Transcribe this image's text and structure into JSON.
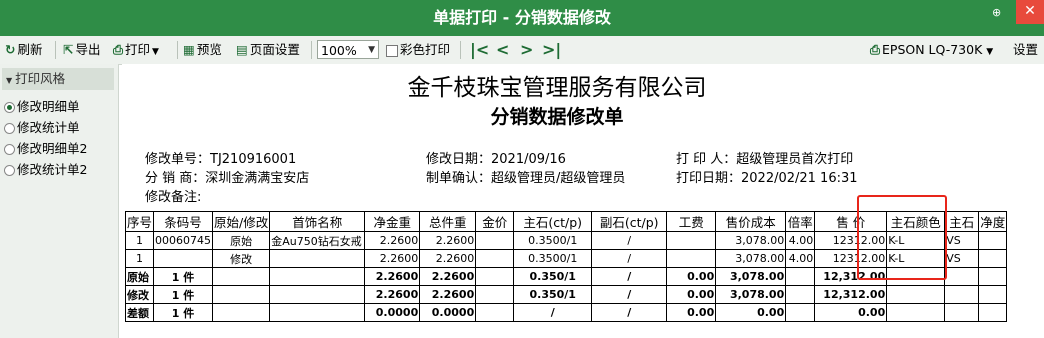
{
  "window": {
    "title": "单据打印 - 分销数据修改",
    "pin_icon": "pin-icon",
    "close_icon": "close-icon"
  },
  "toolbar": {
    "refresh": "刷新",
    "export": "导出",
    "print": "打印",
    "preview": "预览",
    "page_setup": "页面设置",
    "zoom": "100%",
    "color_print": "彩色打印",
    "printer": "EPSON LQ-730K",
    "settings": "设置"
  },
  "left_panel": {
    "header": "打印风格",
    "items": [
      "修改明细单",
      "修改统计单",
      "修改明细单2",
      "修改统计单2"
    ],
    "selected": 0
  },
  "document": {
    "company": "金千枝珠宝管理服务有限公司",
    "title": "分销数据修改单",
    "order_no": "修改单号：TJ210916001",
    "distributor": "分 销 商：深圳金满满宝安店",
    "remark": "修改备注:",
    "modify_date": "修改日期：2021/09/16",
    "confirm": "制单确认：超级管理员/超级管理员",
    "printer_person": "打 印 人：超级管理员首次打印",
    "print_date": "打印日期：2022/02/21 16:31",
    "columns": [
      "序号",
      "条码号",
      "原始/修改",
      "首饰名称",
      "净金重",
      "总件重",
      "金价",
      "主石(ct/p)",
      "副石(ct/p)",
      "工费",
      "售价成本",
      "倍率",
      "售 价",
      "主石颜色",
      "主石",
      "净度"
    ],
    "rows": [
      [
        "1",
        "00060745",
        "原始",
        "金Au750钻石女戒",
        "2.2600",
        "2.2600",
        "",
        "0.3500/1",
        "/",
        "",
        "3,078.00",
        "4.00",
        "12312.00",
        "K-L",
        "VS",
        ""
      ],
      [
        "1",
        "",
        "修改",
        "",
        "2.2600",
        "2.2600",
        "",
        "0.3500/1",
        "/",
        "",
        "3,078.00",
        "4.00",
        "12312.00",
        "K-L",
        "VS",
        ""
      ]
    ],
    "summary": [
      [
        "原始",
        "1 件",
        "",
        "",
        "2.2600",
        "2.2600",
        "",
        "0.350/1",
        "/",
        "0.00",
        "3,078.00",
        "",
        "12,312.00",
        "",
        "",
        ""
      ],
      [
        "修改",
        "1 件",
        "",
        "",
        "2.2600",
        "2.2600",
        "",
        "0.350/1",
        "/",
        "0.00",
        "3,078.00",
        "",
        "12,312.00",
        "",
        "",
        ""
      ],
      [
        "差额",
        "1 件",
        "",
        "",
        "0.0000",
        "0.0000",
        "",
        "/",
        "/",
        "0.00",
        "0.00",
        "",
        "0.00",
        "",
        "",
        ""
      ]
    ]
  },
  "colors": {
    "titlebar": "#2f8d47",
    "highlight": "#e8251a",
    "close": "#e84a3c"
  }
}
